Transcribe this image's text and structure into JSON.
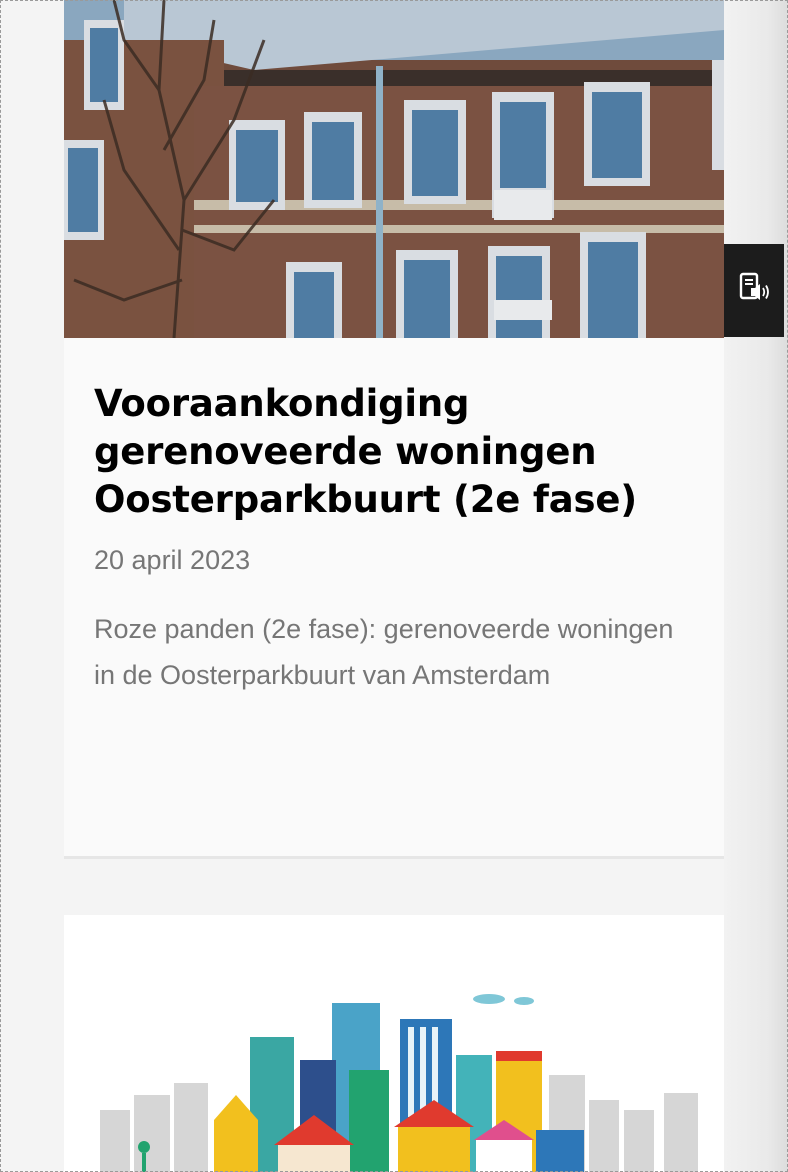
{
  "articles": [
    {
      "title": "Vooraankondiging gerenoveerde woningen Oosterparkbuurt (2e fase)",
      "date": "20 april 2023",
      "description": "Roze panden (2e fase): gerenoveerde woningen in de Oosterparkbuurt van Amsterdam",
      "image": "brick-apartment-building-photo"
    },
    {
      "image": "colorful-city-skyline-illustration"
    }
  ],
  "side_button": {
    "icon": "read-aloud-icon"
  },
  "colors": {
    "background": "#f4f4f4",
    "card": "#fafafa",
    "title": "#000000",
    "meta_text": "#767676",
    "side_button": "#1c1c1c"
  }
}
